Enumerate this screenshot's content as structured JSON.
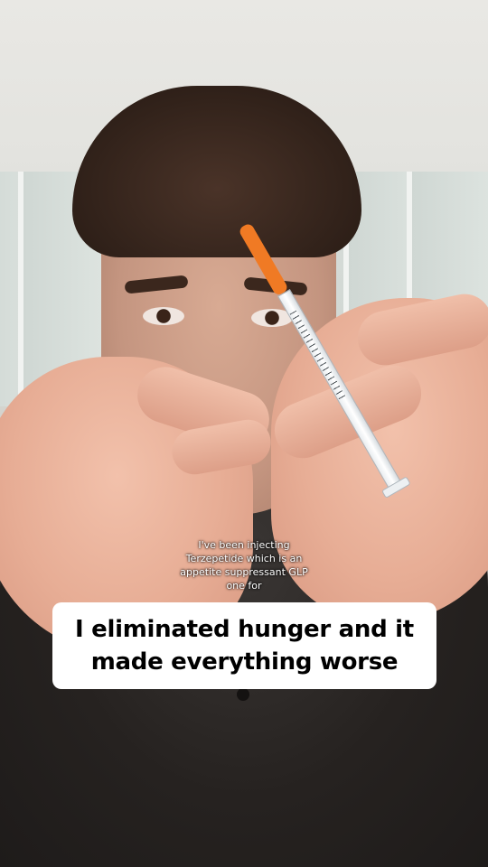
{
  "caption": {
    "line1": "I've been injecting",
    "line2": "Terzepetide which is an",
    "line3": "appetite suppressant GLP",
    "line4": "one for"
  },
  "headline": {
    "line1": "I eliminated hunger and it",
    "line2": "made everything worse"
  },
  "colors": {
    "syringe_cap": "#f07a24",
    "headline_bg": "#ffffff",
    "headline_text": "#000000",
    "caption_text": "#ffffff"
  },
  "icons": {
    "syringe": "syringe-icon"
  }
}
